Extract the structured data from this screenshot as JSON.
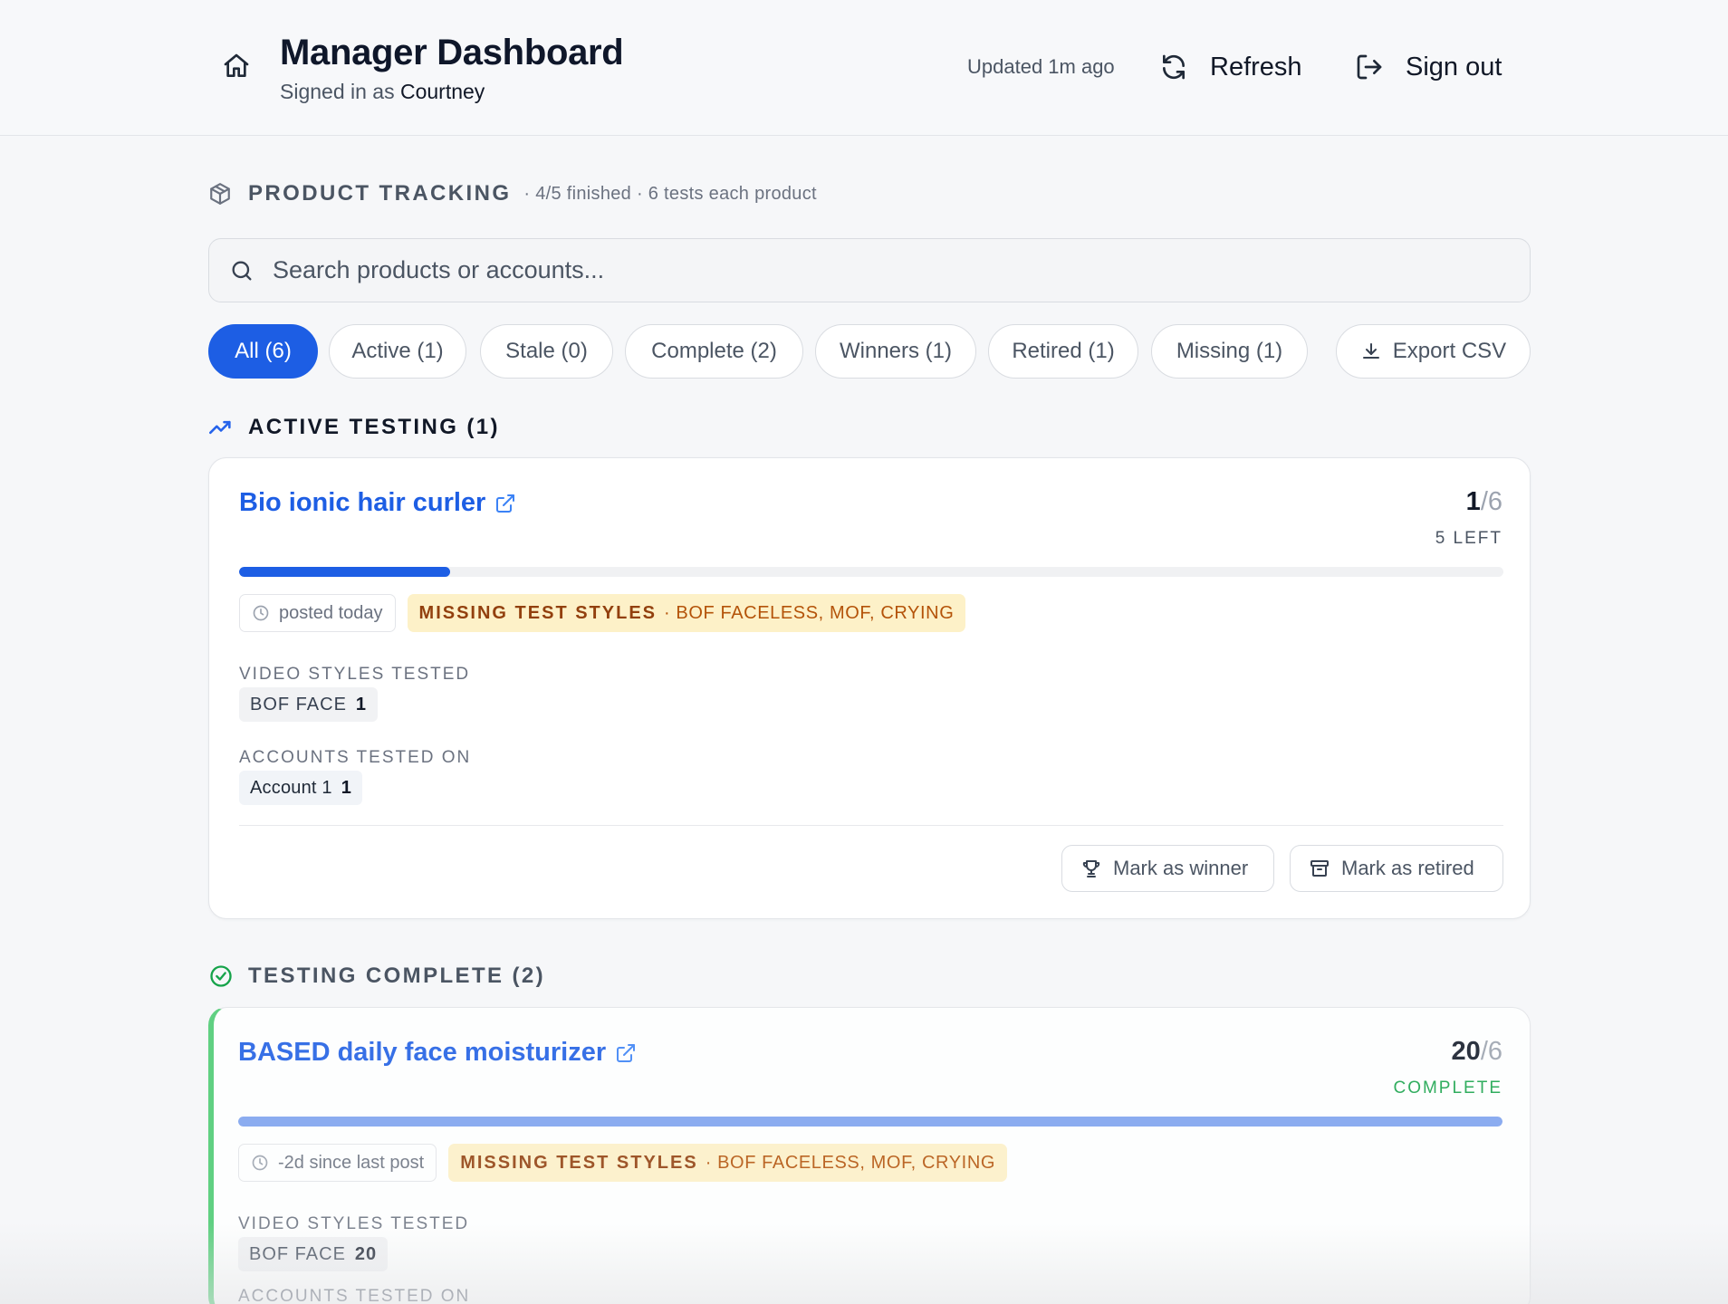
{
  "header": {
    "title": "Manager Dashboard",
    "signed_in_prefix": "Signed in as",
    "user_name": "Courtney",
    "updated": "Updated 1m ago",
    "refresh_label": "Refresh",
    "signout_label": "Sign out"
  },
  "tracking": {
    "title": "PRODUCT TRACKING",
    "meta": "· 4/5 finished · 6 tests each product"
  },
  "search": {
    "placeholder": "Search products or accounts..."
  },
  "filters": [
    {
      "label": "All (6)",
      "active": true
    },
    {
      "label": "Active (1)",
      "active": false
    },
    {
      "label": "Stale (0)",
      "active": false
    },
    {
      "label": "Complete (2)",
      "active": false
    },
    {
      "label": "Winners (1)",
      "active": false
    },
    {
      "label": "Retired (1)",
      "active": false
    },
    {
      "label": "Missing (1)",
      "active": false
    }
  ],
  "export_label": "Export CSV",
  "sections": {
    "active": {
      "title": "ACTIVE TESTING (1)",
      "product": {
        "name": "Bio ionic hair curler",
        "count_done": "1",
        "count_total": "/6",
        "count_status": "5 LEFT",
        "progress": 0.1667,
        "time_chip": "posted today",
        "missing_label": "MISSING TEST STYLES",
        "missing_list": "· BOF FACELESS, MOF, CRYING",
        "video_styles_label": "VIDEO STYLES TESTED",
        "video_styles": [
          {
            "name": "BOF FACE",
            "count": "1"
          }
        ],
        "accounts_label": "ACCOUNTS TESTED ON",
        "accounts": [
          {
            "name": "Account 1",
            "count": "1"
          }
        ],
        "winner_label": "Mark as winner",
        "retired_label": "Mark as retired"
      }
    },
    "complete": {
      "title": "TESTING COMPLETE (2)",
      "product": {
        "name": "BASED daily face moisturizer",
        "count_done": "20",
        "count_total": "/6",
        "count_status": "COMPLETE",
        "progress": 1.0,
        "time_chip": "-2d since last post",
        "missing_label": "MISSING TEST STYLES",
        "missing_list": "· BOF FACELESS, MOF, CRYING",
        "video_styles_label": "VIDEO STYLES TESTED",
        "video_styles": [
          {
            "name": "BOF FACE",
            "count": "20"
          }
        ],
        "accounts_label": "ACCOUNTS TESTED ON"
      }
    }
  },
  "colors": {
    "accent": "#1d5ee4",
    "success": "#16a34a",
    "warning_bg": "#fdf1c8",
    "warning_text": "#92400e"
  }
}
